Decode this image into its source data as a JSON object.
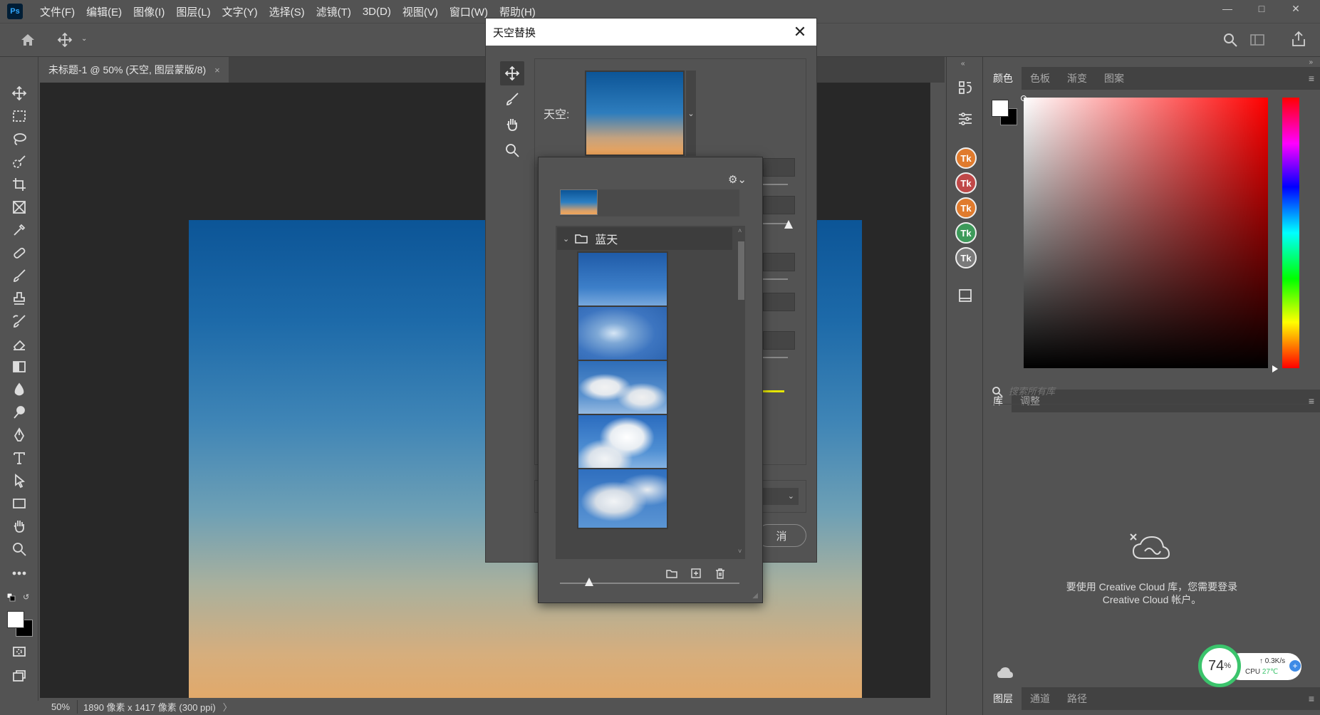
{
  "app": {
    "logo": "Ps"
  },
  "menu": [
    "文件(F)",
    "编辑(E)",
    "图像(I)",
    "图层(L)",
    "文字(Y)",
    "选择(S)",
    "滤镜(T)",
    "3D(D)",
    "视图(V)",
    "窗口(W)",
    "帮助(H)"
  ],
  "document": {
    "tab_title": "未标题-1 @ 50% (天空, 图层蒙版/8)",
    "tab_close": "×",
    "zoom": "50%",
    "info": "1890 像素 x 1417 像素 (300 ppi)",
    "info_arrow": "〉"
  },
  "dialog": {
    "title": "天空替换",
    "close": "✕",
    "sky_label": "天空:",
    "cancel_label": "消"
  },
  "popup": {
    "folder_name": "蓝天",
    "thumbnails": [
      "blue-sky-clear",
      "blue-sky-wisps",
      "blue-sky-cumulus",
      "blue-sky-puffy",
      "blue-sky-clouds"
    ]
  },
  "panels": {
    "color_tabs": [
      "颜色",
      "色板",
      "渐变",
      "图案"
    ],
    "library_tabs": [
      "库",
      "调整"
    ],
    "library_search_placeholder": "搜索所有库",
    "cc_message_line1": "要使用 Creative Cloud 库，您需要登录",
    "cc_message_line2": "Creative Cloud 帐户。",
    "bottom_tabs": [
      "图层",
      "通道",
      "路径"
    ]
  },
  "dock": {
    "tk_labels": [
      "Tk",
      "Tk",
      "Tk",
      "Tk",
      "Tk"
    ],
    "tk_colors": [
      "#e07b2d",
      "#c04848",
      "#e07b2d",
      "#3d9a5a",
      "#7a7a7a"
    ]
  },
  "monitor": {
    "percent": "74",
    "percent_sign": "%",
    "net": "0.3K/s",
    "cpu_label": "CPU",
    "cpu_temp": "27℃"
  },
  "colors": {
    "accent_green": "#3bc46c",
    "canvas_top": "#0c5597",
    "canvas_bottom": "#e8a65f"
  }
}
